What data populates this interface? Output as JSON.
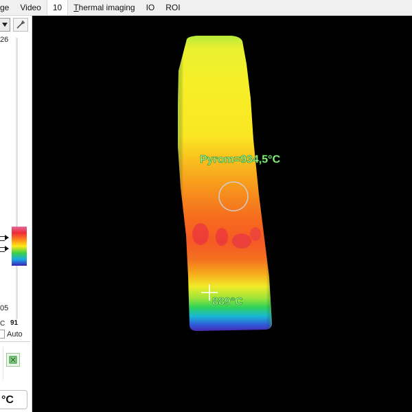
{
  "menu": {
    "items": [
      {
        "label": "ge"
      },
      {
        "label": "Video"
      },
      {
        "label": "10"
      },
      {
        "label_mnemonic": "T",
        "label_rest": "hermal imaging"
      },
      {
        "label": "IO"
      },
      {
        "label": "ROI"
      }
    ]
  },
  "left_panel": {
    "scale_max": "26",
    "scale_min": "05",
    "unit_fragment": "C",
    "value": "91",
    "auto_label": "Auto",
    "temperature_unit": "°C"
  },
  "thermal_view": {
    "pyrometer_label": "Pyrom=934,5°C",
    "spot_label": "889°C",
    "colors": {
      "background": "#000000",
      "label_fill": "#a9ee93",
      "label_outline": "#1a8a2a"
    }
  },
  "icons": [
    "dropdown-arrow-icon",
    "wrench-icon",
    "fit-view-icon",
    "pyrometer-circle-icon",
    "crosshair-icon"
  ]
}
